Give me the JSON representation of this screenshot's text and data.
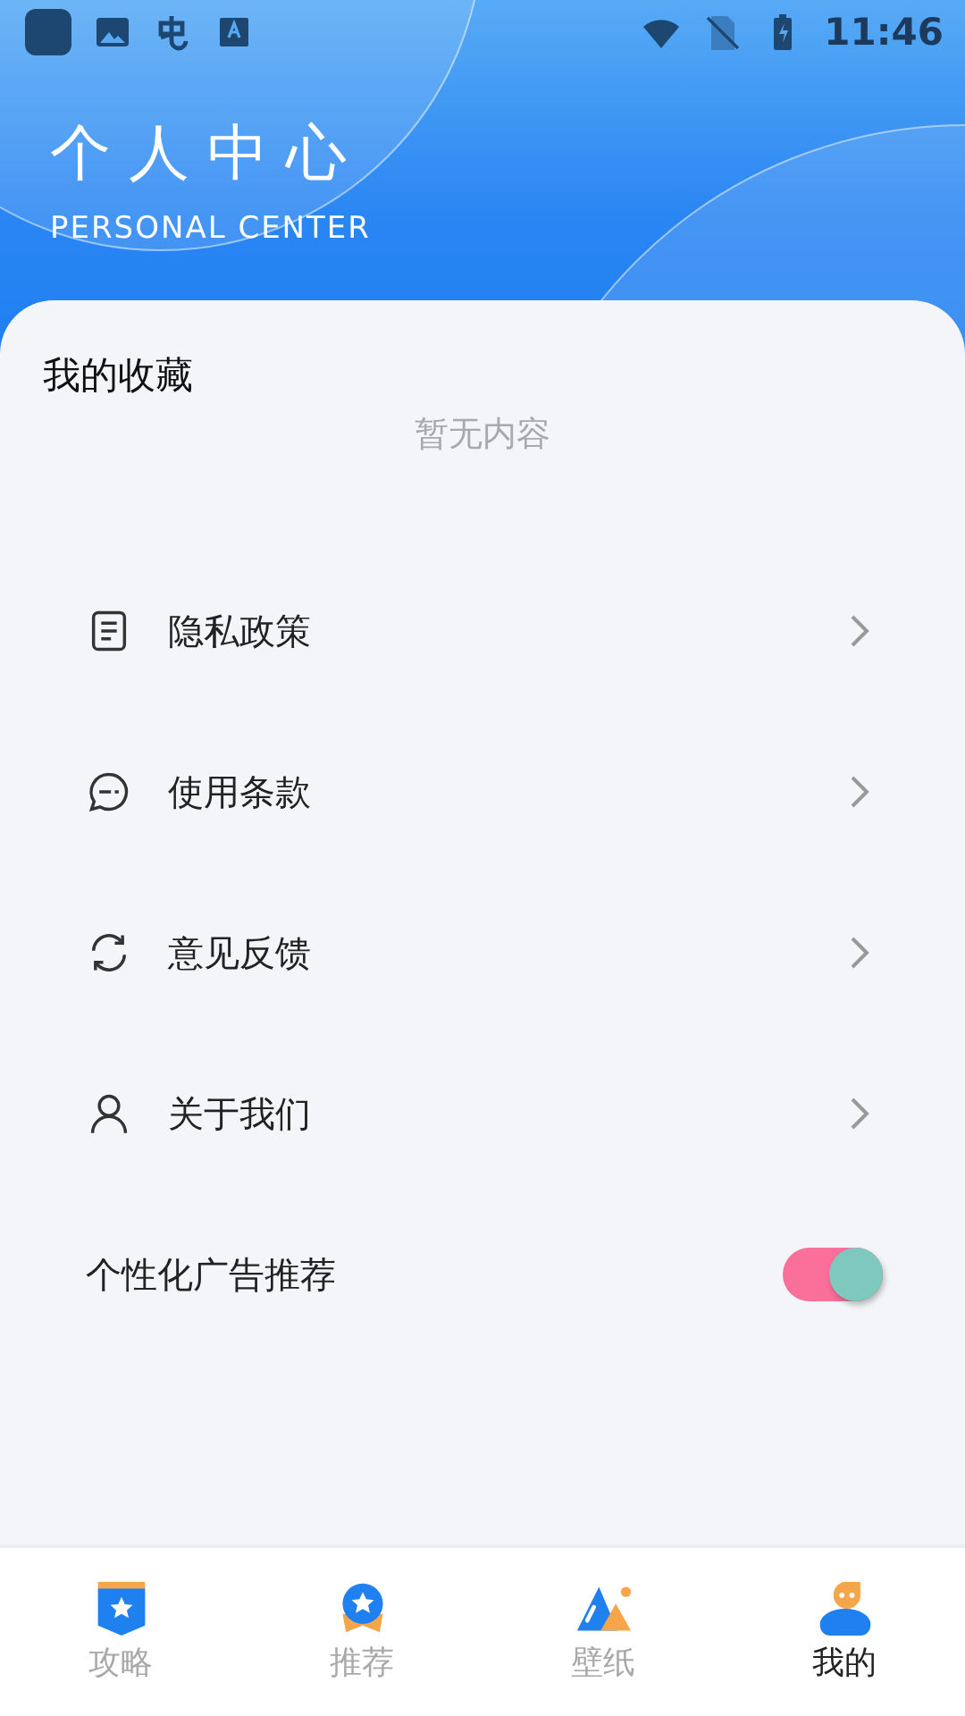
{
  "status_bar": {
    "time": "11:46"
  },
  "header": {
    "title": "个人中心",
    "subtitle": "PERSONAL CENTER"
  },
  "favorites": {
    "title": "我的收藏",
    "empty_text": "暂无内容"
  },
  "menu": [
    {
      "kind": "link",
      "label": "隐私政策"
    },
    {
      "kind": "link",
      "label": "使用条款"
    },
    {
      "kind": "link",
      "label": "意见反馈"
    },
    {
      "kind": "link",
      "label": "关于我们"
    },
    {
      "kind": "toggle",
      "label": "个性化广告推荐",
      "on": true
    }
  ],
  "bottom_nav": [
    {
      "label": "攻略",
      "selected": false
    },
    {
      "label": "推荐",
      "selected": false
    },
    {
      "label": "壁纸",
      "selected": false
    },
    {
      "label": "我的",
      "selected": true
    }
  ]
}
